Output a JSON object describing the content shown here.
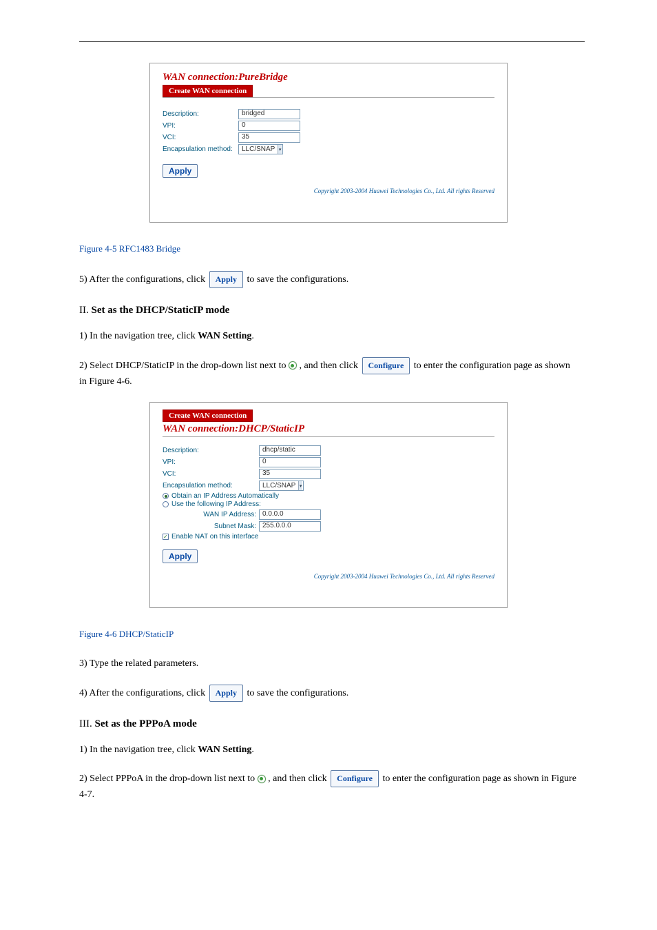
{
  "panel1": {
    "title": "WAN connection:PureBridge",
    "tab_label": "Create WAN connection",
    "rows": {
      "description_label": "Description:",
      "description_value": "bridged",
      "vpi_label": "VPI:",
      "vpi_value": "0",
      "vci_label": "VCI:",
      "vci_value": "35",
      "encap_label": "Encapsulation method:",
      "encap_value": "LLC/SNAP"
    },
    "apply": "Apply",
    "copyright": "Copyright 2003-2004 Huawei Technologies Co., Ltd. All rights Reserved"
  },
  "figure1": "Figure 4-5 RFC1483 Bridge",
  "body1_a": "5) ",
  "body1_b": "After the configurations, click ",
  "body1_c": " to save the configurations.",
  "section2_number": "II. ",
  "section2_title": "Set as the DHCP/StaticIP mode",
  "body2_a": "1) ",
  "body2_b": "In the navigation tree, click ",
  "body2_c": "WAN Setting",
  "body2_d": ".",
  "body3_a": "2) ",
  "body3_b": "Select DHCP/StaticIP in the drop-down list next to ",
  "body3_c": ", and then click ",
  "body3_d": " to enter the configuration page as shown in Figure 4-6.",
  "configure_btn": "Configure",
  "panel2": {
    "tab_label": "Create WAN connection",
    "title": "WAN connection:DHCP/StaticIP",
    "rows": {
      "description_label": "Description:",
      "description_value": "dhcp/static",
      "vpi_label": "VPI:",
      "vpi_value": "0",
      "vci_label": "VCI:",
      "vci_value": "35",
      "encap_label": "Encapsulation method:",
      "encap_value": "LLC/SNAP",
      "radio1": "Obtain an IP Address Automatically",
      "radio2": "Use the following IP Address:",
      "wan_ip_label": "WAN IP Address:",
      "wan_ip_value": "0.0.0.0",
      "subnet_label": "Subnet Mask:",
      "subnet_value": "255.0.0.0",
      "nat_label": "Enable NAT on this interface"
    },
    "apply": "Apply",
    "copyright": "Copyright 2003-2004 Huawei Technologies Co., Ltd. All rights Reserved"
  },
  "figure2": "Figure 4-6 DHCP/StaticIP",
  "body4_a": "3) ",
  "body4_b": "Type the related parameters.",
  "body5_a": "4) ",
  "body5_b": "After the configurations, click ",
  "body5_c": " to save the configurations.",
  "section3_number": "III. ",
  "section3_title": "Set as the PPPoA mode",
  "body6_a": "1) ",
  "body6_b": "In the navigation tree, click ",
  "body6_c": "WAN Setting",
  "body6_d": ".",
  "body7_a": "2) ",
  "body7_b": "Select PPPoA in the drop-down list next to ",
  "body7_c": ", and then click ",
  "body7_d": " to enter the configuration page as shown in Figure 4-7.",
  "apply_inline": "Apply"
}
